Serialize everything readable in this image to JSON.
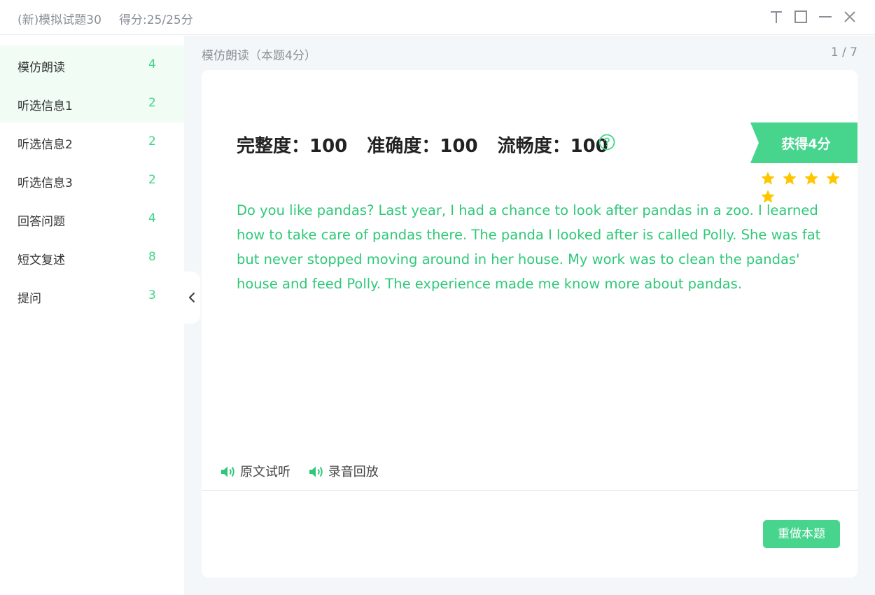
{
  "titlebar": {
    "title": "(新)模拟试题30",
    "score": "得分:25/25分",
    "buttons": [
      "pin-icon",
      "maximize-icon",
      "minimize-icon",
      "close-icon"
    ]
  },
  "sidebar": {
    "items": [
      {
        "label": "模仿朗读",
        "count": "4",
        "active": true
      },
      {
        "label": "听选信息1",
        "count": "2",
        "active": true
      },
      {
        "label": "听选信息2",
        "count": "2",
        "active": false
      },
      {
        "label": "听选信息3",
        "count": "2",
        "active": false
      },
      {
        "label": "回答问题",
        "count": "4",
        "active": false
      },
      {
        "label": "短文复述",
        "count": "8",
        "active": false
      },
      {
        "label": "提问",
        "count": "3",
        "active": false
      }
    ],
    "collapse_icon": "chevron-left-icon"
  },
  "main": {
    "section_title": "模仿朗读（本题4分）",
    "pager": "1 / 7",
    "metrics": [
      {
        "text": "完整度：100"
      },
      {
        "text": "准确度：100"
      },
      {
        "text": "流畅度：100"
      }
    ],
    "help_icon": "question-circle-icon",
    "earned": "获得4分",
    "stars": 5,
    "passage": "Do you like pandas? Last year, I had a chance to look after pandas in a zoo. I learned how to take care of pandas there. The panda I looked after is called Polly. She was fat but never stopped moving around in her house. My work was to clean the pandas' house and feed Polly. The experience made me know more about pandas.",
    "audio": {
      "original_label": "原文试听",
      "playback_label": "录音回放",
      "icon": "speaker-icon"
    },
    "redo_label": "重做本题"
  },
  "colors": {
    "accent": "#47d48d",
    "passage": "#2fc878",
    "star": "#ffc600",
    "sidebar_active": "#f0fcf4",
    "main_bg": "#f4f7fa"
  }
}
